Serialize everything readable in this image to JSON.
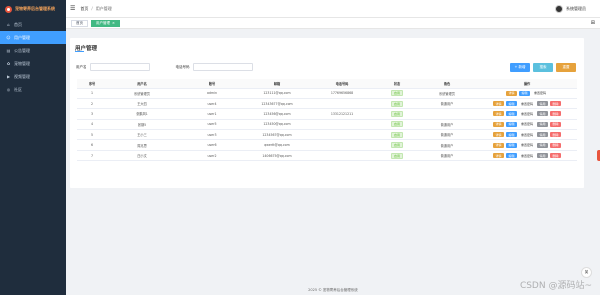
{
  "app": {
    "title": "宠物寄养后台管理系统"
  },
  "sidebar": {
    "items": [
      {
        "label": "首页",
        "icon": "home-icon",
        "active": false
      },
      {
        "label": "用户管理",
        "icon": "user-icon",
        "active": true
      },
      {
        "label": "公告管理",
        "icon": "notice-icon",
        "active": false
      },
      {
        "label": "宠物管理",
        "icon": "pet-icon",
        "active": false
      },
      {
        "label": "视频管理",
        "icon": "video-icon",
        "active": false
      },
      {
        "label": "社区",
        "icon": "community-icon",
        "active": false
      }
    ]
  },
  "topbar": {
    "breadcrumb": [
      "首页",
      "用户管理"
    ],
    "username": "系统管理员"
  },
  "tabs": [
    {
      "label": "首页",
      "active": false
    },
    {
      "label": "用户管理",
      "active": true
    }
  ],
  "page": {
    "title": "用户管理",
    "search": {
      "username_label": "用户名",
      "username_value": "",
      "phone_label": "电话号码",
      "phone_value": ""
    },
    "buttons": {
      "add": "+ 新增",
      "search": "搜索",
      "reset": "重置"
    }
  },
  "table": {
    "headers": [
      "序号",
      "用户名",
      "账号",
      "邮箱",
      "电话号码",
      "状态",
      "角色",
      "操作"
    ],
    "rows": [
      {
        "index": "1",
        "name": "系统管理员",
        "account": "admin",
        "email": "123111@qq.com",
        "phone": "17769656868",
        "status": "启用",
        "role": "系统管理员",
        "ops": [
          "详情",
          "编辑",
          "重置密码"
        ]
      },
      {
        "index": "2",
        "name": "王大四",
        "account": "user4",
        "email": "12343677@qq.com",
        "phone": "",
        "status": "启用",
        "role": "普通用户",
        "ops": [
          "详情",
          "编辑",
          "重置密码",
          "停用",
          "删除"
        ]
      },
      {
        "index": "3",
        "name": "张鹏风1",
        "account": "user1",
        "email": "123456@qq.com",
        "phone": "13312121211",
        "status": "启用",
        "role": "",
        "ops": [
          "详情",
          "编辑",
          "重置密码",
          "停用",
          "删除"
        ]
      },
      {
        "index": "4",
        "name": "张钢5",
        "account": "user5",
        "email": "123450@qq.com",
        "phone": "",
        "status": "启用",
        "role": "普通用户",
        "ops": [
          "详情",
          "编辑",
          "重置密码",
          "停用",
          "删除"
        ]
      },
      {
        "index": "5",
        "name": "王小三",
        "account": "user3",
        "email": "1234567@qq.com",
        "phone": "",
        "status": "启用",
        "role": "普通用户",
        "ops": [
          "详情",
          "编辑",
          "重置密码",
          "停用",
          "删除"
        ]
      },
      {
        "index": "6",
        "name": "周兆思",
        "account": "user6",
        "email": "qwertt@qq.com",
        "phone": "",
        "status": "启用",
        "role": "普通用户",
        "ops": [
          "详情",
          "编辑",
          "重置密码",
          "停用",
          "删除"
        ]
      },
      {
        "index": "7",
        "name": "庄小文",
        "account": "user2",
        "email": "1406675@qq.com",
        "phone": "",
        "status": "启用",
        "role": "普通用户",
        "ops": [
          "详情",
          "编辑",
          "重置密码",
          "停用",
          "删除"
        ]
      }
    ]
  },
  "footer": {
    "text": "2025 © 宠物寄养后台管理系统"
  },
  "watermark": "CSDN @源码站~",
  "float_icon": "英",
  "colors": {
    "primary": "#409eff",
    "sidebar": "#1f2d3d",
    "tab_active": "#42b983",
    "warning": "#e6a23c",
    "danger": "#f56c6c"
  }
}
